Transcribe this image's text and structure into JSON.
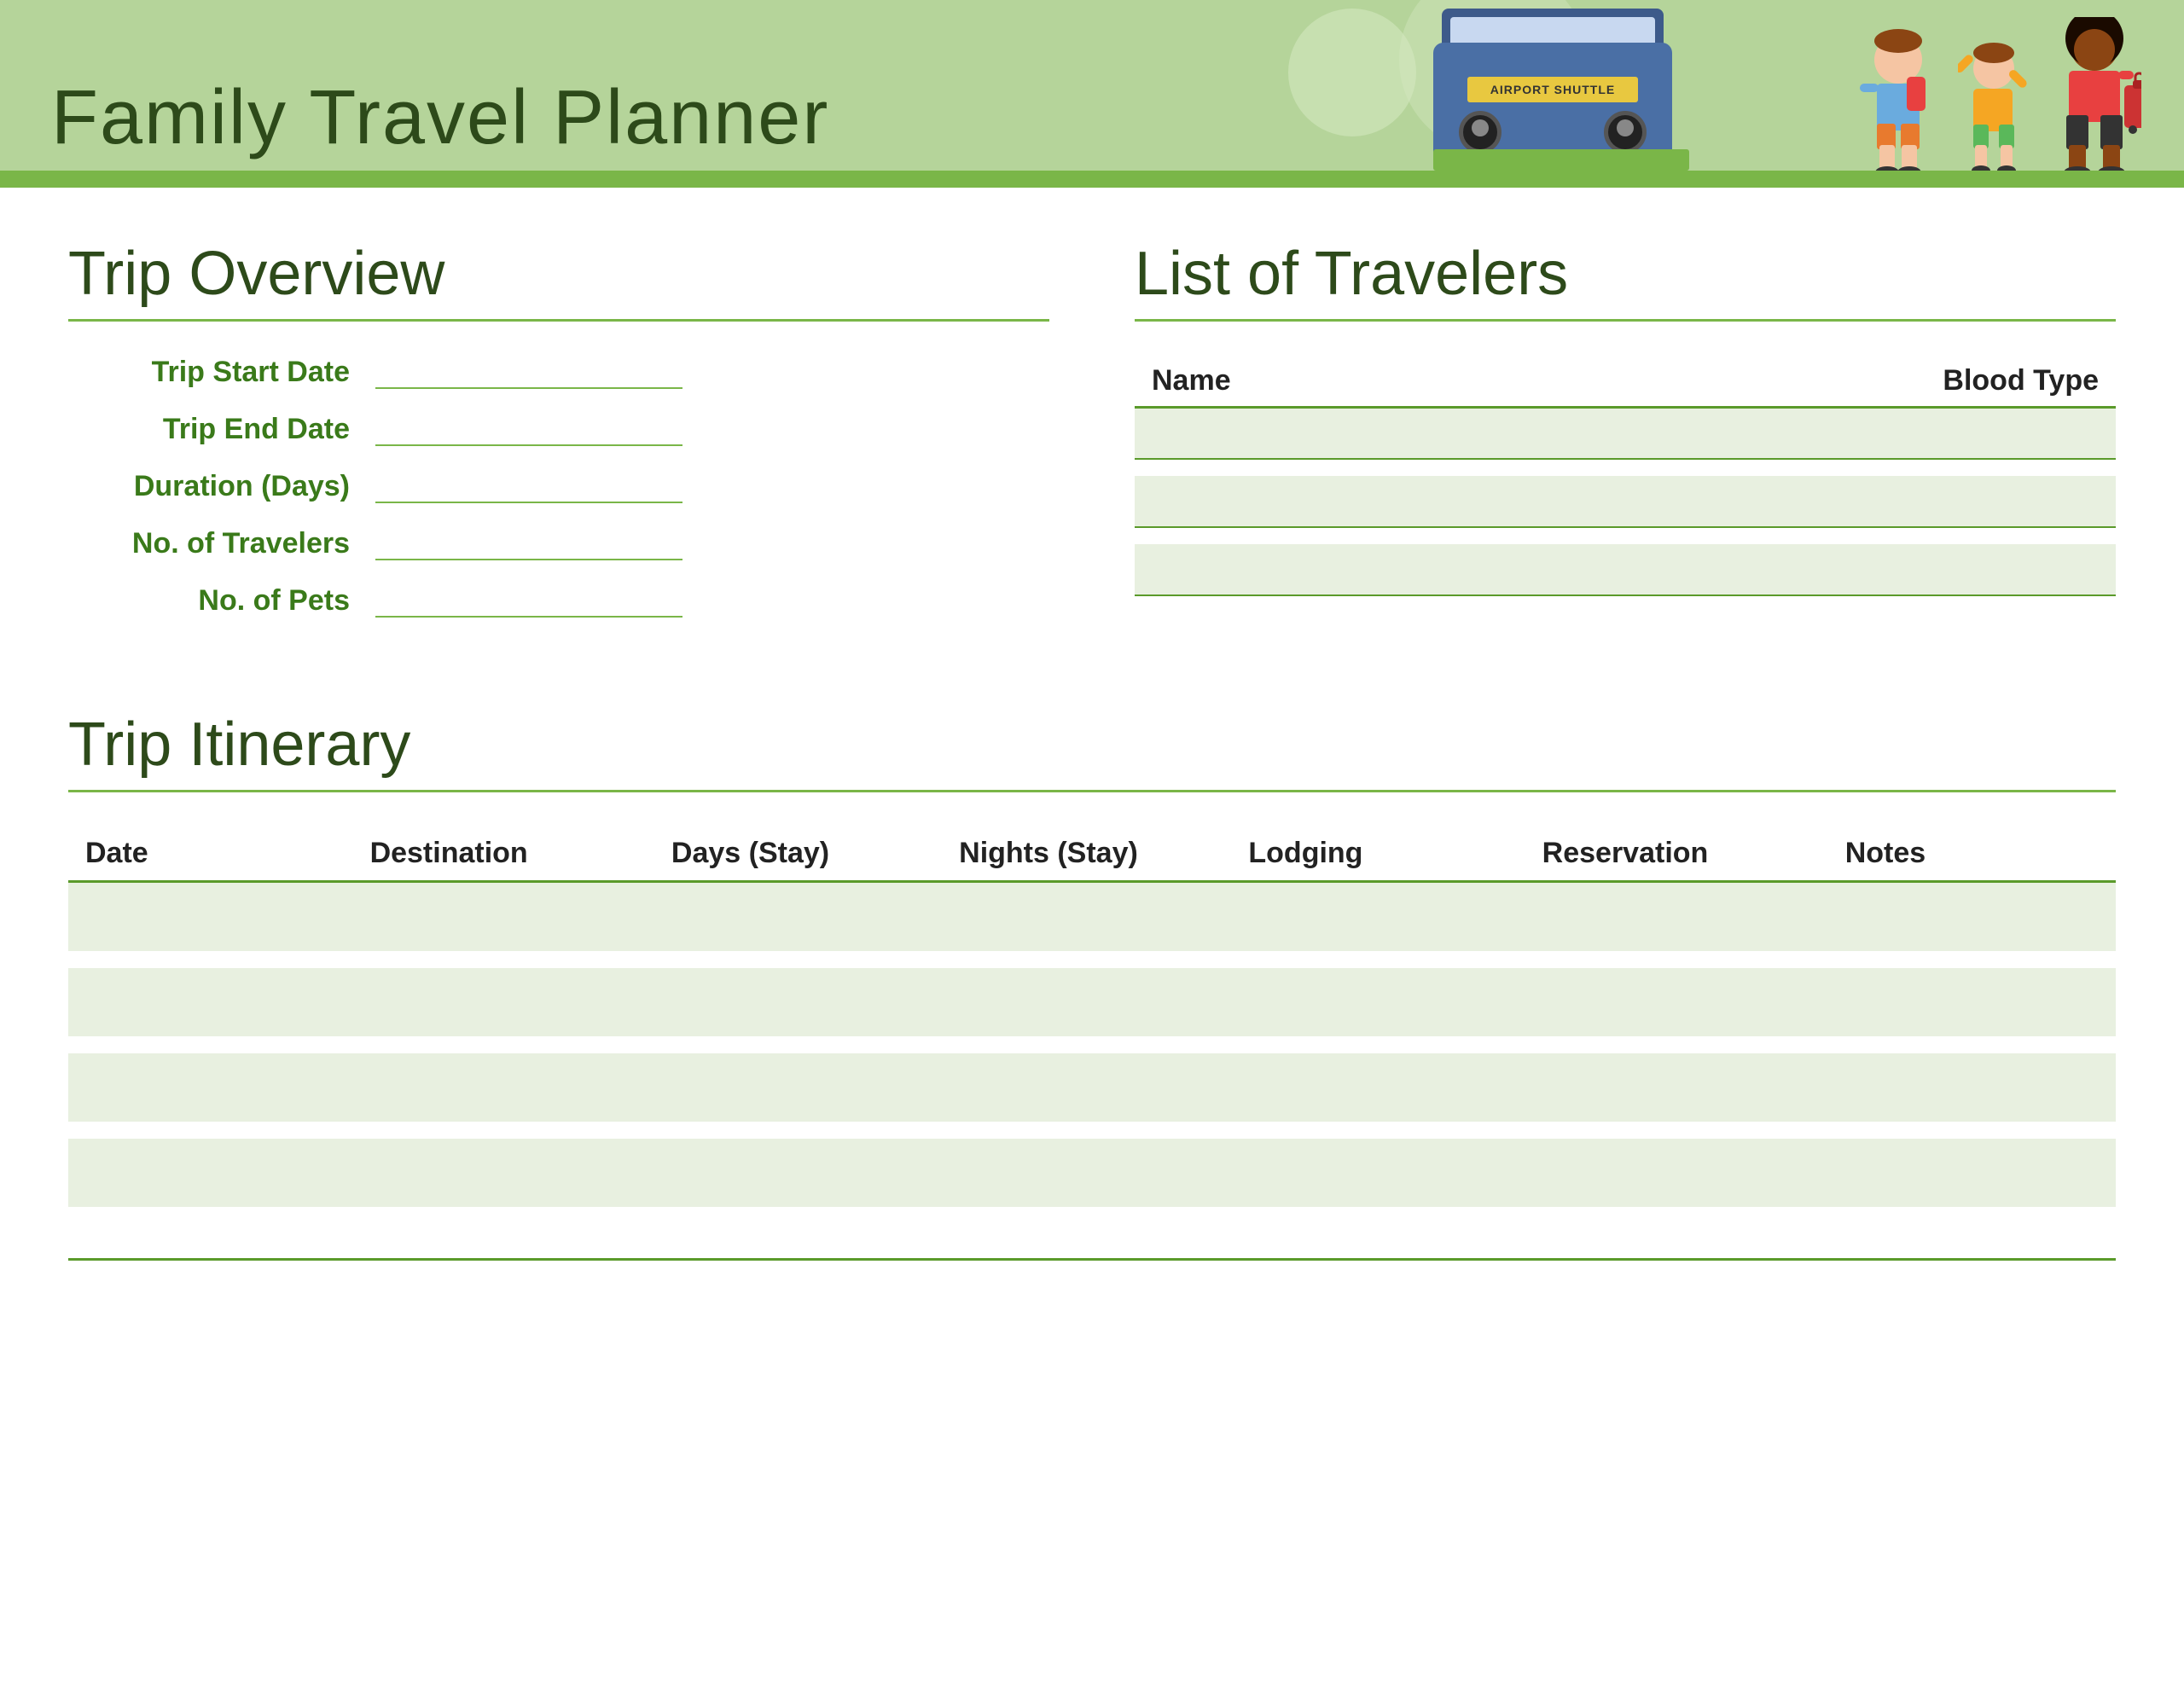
{
  "header": {
    "title": "Family Travel Planner",
    "bus_sign": "AIRPORT SHUTTLE"
  },
  "trip_overview": {
    "section_title": "Trip Overview",
    "fields": [
      {
        "label": "Trip Start Date",
        "value": ""
      },
      {
        "label": "Trip End Date",
        "value": ""
      },
      {
        "label": "Duration (Days)",
        "value": ""
      },
      {
        "label": "No. of Travelers",
        "value": ""
      },
      {
        "label": "No. of Pets",
        "value": ""
      }
    ]
  },
  "travelers": {
    "section_title": "List of Travelers",
    "columns": [
      "Name",
      "Blood Type"
    ],
    "rows": [
      {
        "name": "",
        "blood_type": ""
      },
      {
        "name": "",
        "blood_type": ""
      },
      {
        "name": "",
        "blood_type": ""
      }
    ]
  },
  "itinerary": {
    "section_title": "Trip Itinerary",
    "columns": [
      "Date",
      "Destination",
      "Days (Stay)",
      "Nights (Stay)",
      "Lodging",
      "Reservation",
      "Notes"
    ],
    "rows": [
      {
        "date": "",
        "destination": "",
        "days": "",
        "nights": "",
        "lodging": "",
        "reservation": "",
        "notes": ""
      },
      {
        "date": "",
        "destination": "",
        "days": "",
        "nights": "",
        "lodging": "",
        "reservation": "",
        "notes": ""
      },
      {
        "date": "",
        "destination": "",
        "days": "",
        "nights": "",
        "lodging": "",
        "reservation": "",
        "notes": ""
      },
      {
        "date": "",
        "destination": "",
        "days": "",
        "nights": "",
        "lodging": "",
        "reservation": "",
        "notes": ""
      }
    ]
  }
}
